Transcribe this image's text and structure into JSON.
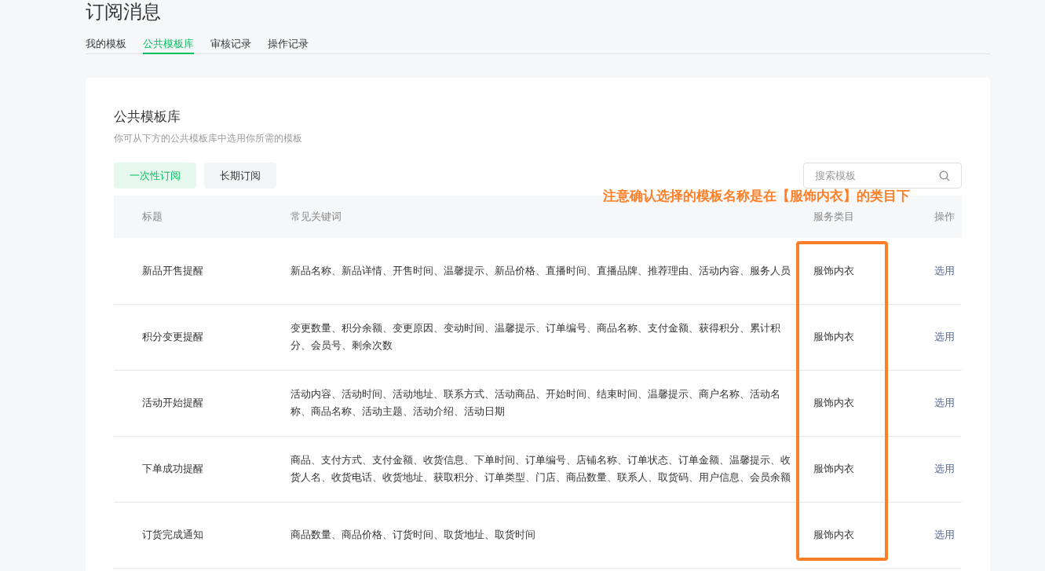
{
  "page_title": "订阅消息",
  "tabs": [
    {
      "label": "我的模板",
      "selected": false
    },
    {
      "label": "公共模板库",
      "selected": true
    },
    {
      "label": "审核记录",
      "selected": false
    },
    {
      "label": "操作记录",
      "selected": false
    }
  ],
  "panel": {
    "title": "公共模板库",
    "subtitle": "你可从下方的公共模板库中选用你所需的模板"
  },
  "filters": [
    {
      "label": "一次性订阅",
      "selected": true
    },
    {
      "label": "长期订阅",
      "selected": false
    }
  ],
  "search": {
    "placeholder": "搜索模板"
  },
  "annotation": {
    "text": "注意确认选择的模板名称是在【服饰内衣】的类目下"
  },
  "table": {
    "columns": [
      "标题",
      "常见关键词",
      "服务类目",
      "操作"
    ],
    "rows": [
      {
        "title": "新品开售提醒",
        "keywords": "新品名称、新品详情、开售时间、温馨提示、新品价格、直播时间、直播品牌、推荐理由、活动内容、服务人员",
        "category": "服饰内衣",
        "action": "选用"
      },
      {
        "title": "积分变更提醒",
        "keywords": "变更数量、积分余额、变更原因、变动时间、温馨提示、订单编号、商品名称、支付金额、获得积分、累计积分、会员号、剩余次数",
        "category": "服饰内衣",
        "action": "选用"
      },
      {
        "title": "活动开始提醒",
        "keywords": "活动内容、活动时间、活动地址、联系方式、活动商品、开始时间、结束时间、温馨提示、商户名称、活动名称、商品名称、活动主题、活动介绍、活动日期",
        "category": "服饰内衣",
        "action": "选用"
      },
      {
        "title": "下单成功提醒",
        "keywords": "商品、支付方式、支付金额、收货信息、下单时间、订单编号、店铺名称、订单状态、订单金额、温馨提示、收货人名、收货电话、收货地址、获取积分、订单类型、门店、商品数量、联系人、取货码、用户信息、会员余额",
        "category": "服饰内衣",
        "action": "选用"
      },
      {
        "title": "订货完成通知",
        "keywords": "商品数量、商品价格、订货时间、取货地址、取货时间",
        "category": "服饰内衣",
        "action": "选用"
      }
    ]
  }
}
